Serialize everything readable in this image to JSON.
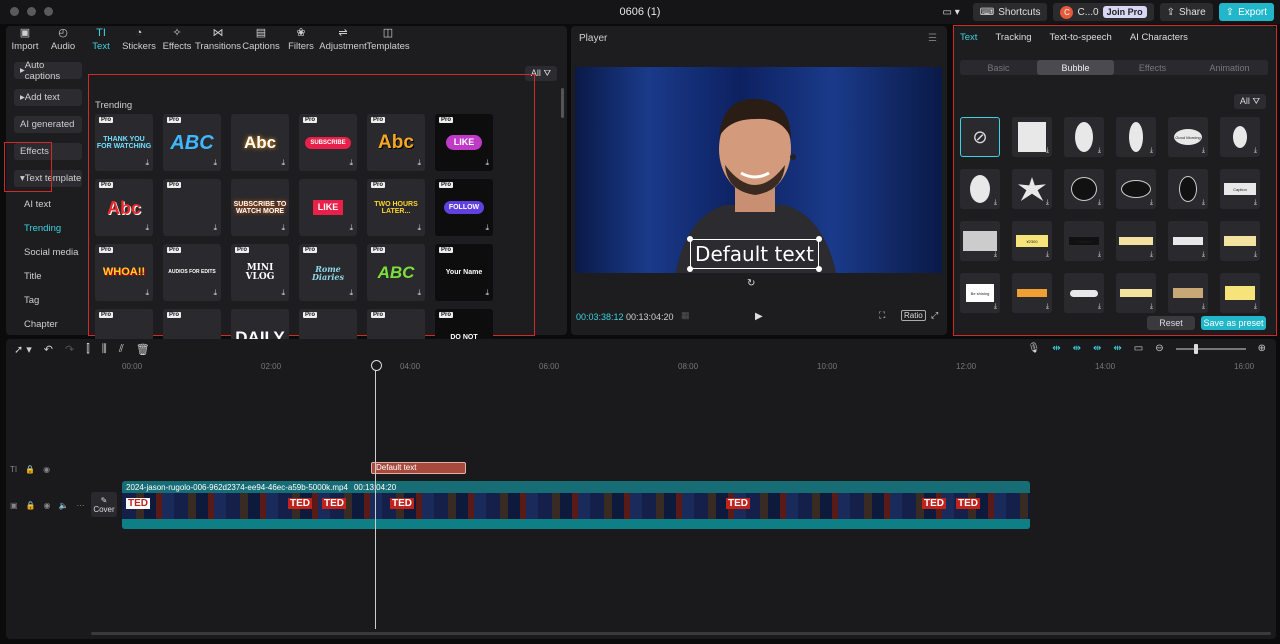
{
  "window": {
    "title": "0606 (1)"
  },
  "topbar": {
    "shortcuts": "Shortcuts",
    "user": "C...0",
    "avatar_letter": "C",
    "join_pro": "Join Pro",
    "share": "Share",
    "export": "Export"
  },
  "categories": [
    {
      "label": "Import",
      "icon": "import-icon"
    },
    {
      "label": "Audio",
      "icon": "audio-icon"
    },
    {
      "label": "Text",
      "icon": "text-icon",
      "active": true
    },
    {
      "label": "Stickers",
      "icon": "sticker-icon"
    },
    {
      "label": "Effects",
      "icon": "effects-icon"
    },
    {
      "label": "Transitions",
      "icon": "transitions-icon"
    },
    {
      "label": "Captions",
      "icon": "captions-icon"
    },
    {
      "label": "Filters",
      "icon": "filters-icon"
    },
    {
      "label": "Adjustment",
      "icon": "adjustment-icon"
    },
    {
      "label": "Templates",
      "icon": "templates-icon"
    }
  ],
  "sidebar": {
    "auto_captions": "Auto captions",
    "add_text": "Add text",
    "ai_generated": "AI generated",
    "effects": "Effects",
    "text_template": "Text template",
    "items": [
      "AI text",
      "Trending",
      "Social media",
      "Title",
      "Tag",
      "Chapter"
    ]
  },
  "library": {
    "filter": "All",
    "section": "Trending",
    "pro_badge": "Pro",
    "tiles": [
      "THANK YOU FOR WATCHING",
      "ABC",
      "Abc",
      "SUBSCRIBE",
      "Abc",
      "LIKE",
      "Abc",
      "",
      "SUBSCRIBE TO WATCH MORE",
      "LIKE",
      "TWO HOURS LATER...",
      "FOLLOW",
      "WHOA!!",
      "AUDIOS FOR EDITS",
      "MINI VLOG",
      "Rome Diaries",
      "ABC",
      "Your Name",
      "",
      "",
      "DAILY",
      "",
      "",
      "DO NOT"
    ]
  },
  "player": {
    "title": "Player",
    "overlay_text": "Default text",
    "current_time": "00:03:38:12",
    "total_time": "00:13:04:20",
    "ratio": "Ratio"
  },
  "inspector": {
    "tabs": [
      "Text",
      "Tracking",
      "Text-to-speech",
      "AI Characters"
    ],
    "subtabs": [
      "Basic",
      "Bubble",
      "Effects",
      "Animation"
    ],
    "filter": "All",
    "bubbles": [
      "",
      "",
      "",
      "",
      "Good Morning",
      "",
      "",
      "",
      "",
      "",
      "",
      "Caption",
      "",
      "¥2300",
      "Seafood",
      "",
      "",
      "",
      "Be shining",
      "",
      "",
      "",
      "",
      ""
    ],
    "reset": "Reset",
    "save_preset": "Save as preset"
  },
  "timeline": {
    "ruler": [
      "00:00",
      "02:00",
      "04:00",
      "06:00",
      "08:00",
      "10:00",
      "12:00",
      "14:00",
      "16:00"
    ],
    "text_clip": "Default text",
    "video_clip_name": "2024-jason-rugolo-006-962d2374-ee94-46ec-a59b-5000k.mp4",
    "video_clip_duration": "00:13:04:20",
    "cover": "Cover",
    "ted_logo": "TED"
  },
  "colors": {
    "accent": "#21b6c9",
    "highlight": "#3dd3e0",
    "annotation": "#d22a2a",
    "clip_video": "#166d75",
    "clip_text": "#a74a3d"
  }
}
